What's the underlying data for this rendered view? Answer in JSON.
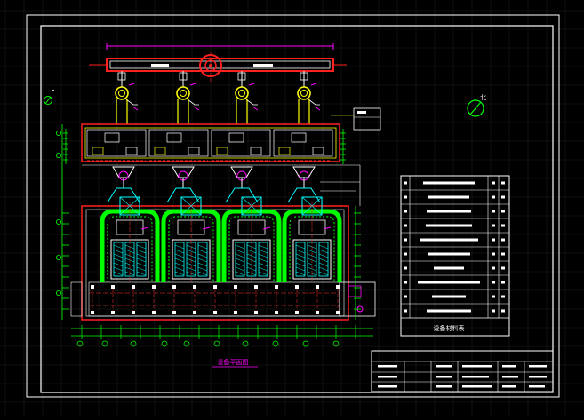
{
  "drawing": {
    "plan_title": "设备平面图",
    "materials_table_title": "设备材料表",
    "materials_row_count": 10,
    "units_count": 4
  },
  "colors": {
    "background": "#000000",
    "frame": "#ffffff",
    "equipment": "#ffffff",
    "walls": "#ff2020",
    "hatch": "#00ff00",
    "duct": "#ffff00",
    "annotation": "#ff00ff",
    "structure": "#00ffff",
    "center_lines": "#ff3030"
  },
  "icons": {
    "north_arrow": "north-arrow-icon",
    "compass": "compass-icon"
  }
}
